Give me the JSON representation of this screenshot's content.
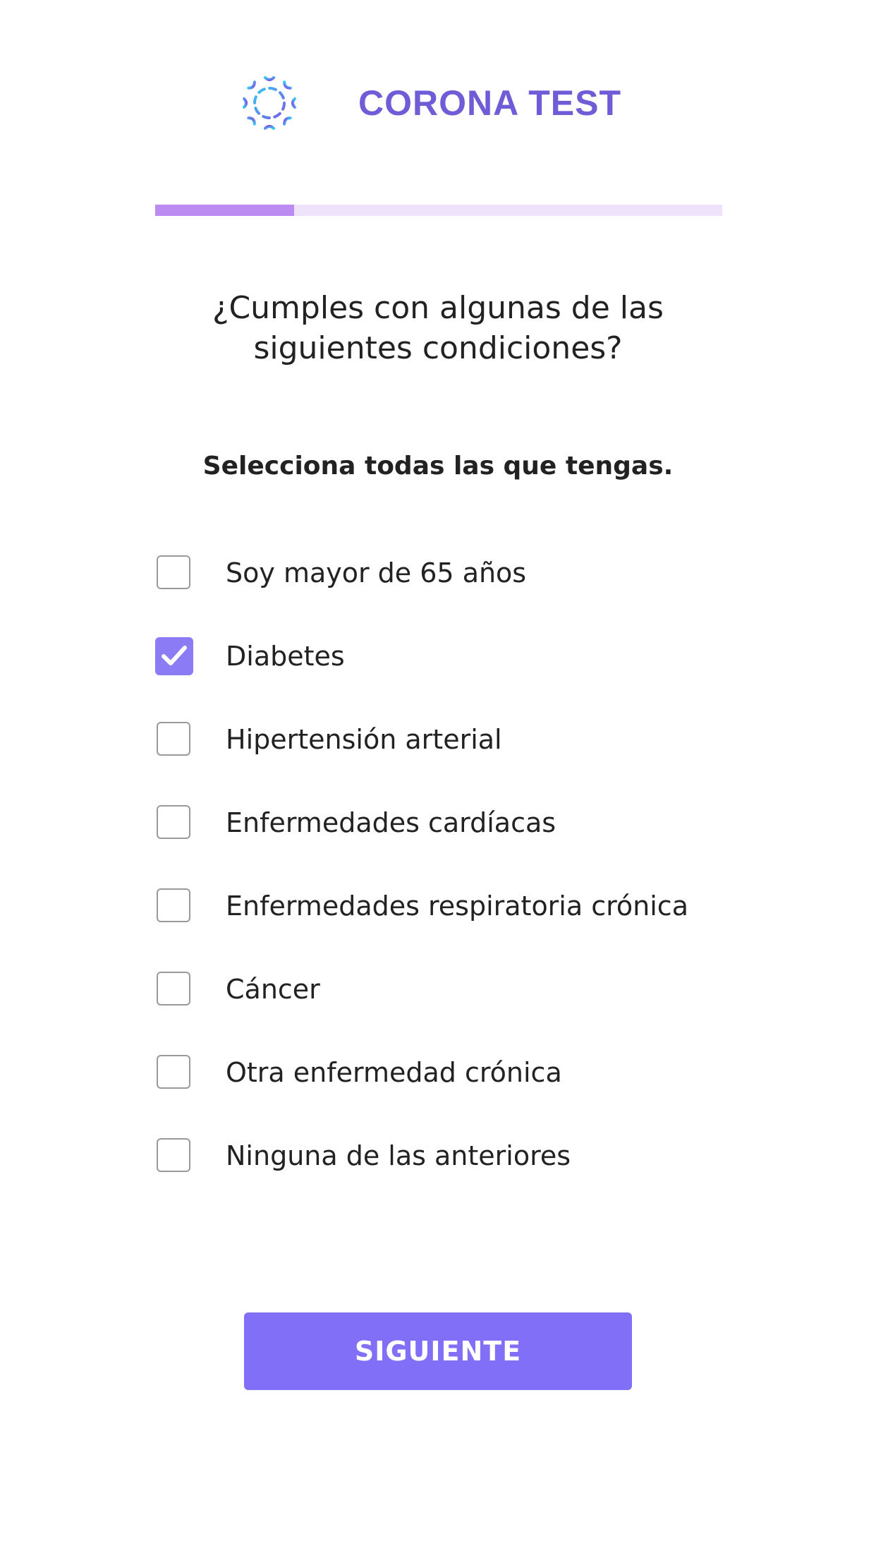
{
  "header": {
    "logo_icon": "virus-cell-icon",
    "title": "CORONA TEST",
    "title_color": "#6e5dd6"
  },
  "progress": {
    "fraction": 0.245,
    "fill_color": "#bb8bf2",
    "track_color": "#efe3fb"
  },
  "question": {
    "text": "¿Cumples con algunas de las siguientes condiciones?",
    "hint": "Selecciona todas las que tengas."
  },
  "options": [
    {
      "label": "Soy mayor de 65 años",
      "checked": false
    },
    {
      "label": "Diabetes",
      "checked": true
    },
    {
      "label": "Hipertensión arterial",
      "checked": false
    },
    {
      "label": "Enfermedades cardíacas",
      "checked": false
    },
    {
      "label": "Enfermedades respiratoria crónica",
      "checked": false
    },
    {
      "label": "Cáncer",
      "checked": false
    },
    {
      "label": "Otra enfermedad crónica",
      "checked": false
    },
    {
      "label": "Ninguna de las anteriores",
      "checked": false
    }
  ],
  "footer": {
    "next_label": "SIGUIENTE",
    "button_color": "#8170f7"
  }
}
